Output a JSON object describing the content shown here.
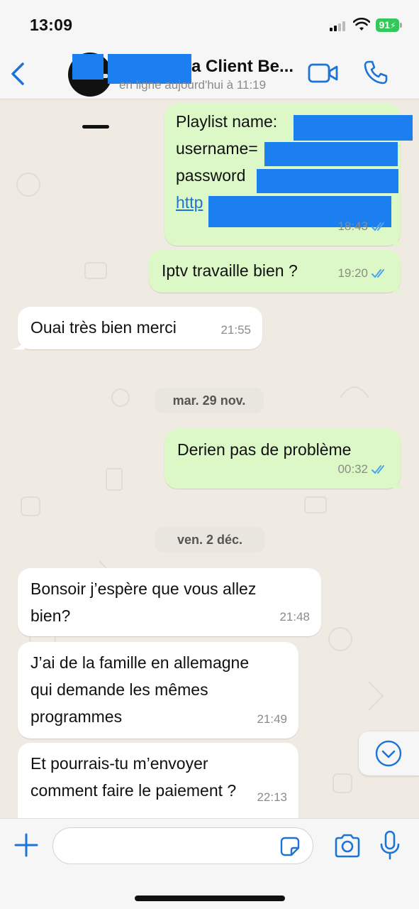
{
  "status_bar": {
    "time": "13:09",
    "battery": "91",
    "battery_color": "#34c759",
    "icons": [
      "signal-icon",
      "wifi-icon",
      "battery-charging-icon"
    ]
  },
  "header": {
    "contact_name": "a Client Be...",
    "contact_status": "en ligne aujourd'hui à 11:19",
    "icons": [
      "chevron-left-icon",
      "video-call-icon",
      "phone-call-icon"
    ],
    "accent_color": "#1d74d8"
  },
  "messages": [
    {
      "direction": "out",
      "lines": [
        "Playlist name:",
        "username=",
        "password",
        "http"
      ],
      "time": "18:43",
      "read": true
    },
    {
      "direction": "out",
      "text": "Iptv travaille bien ?",
      "time": "19:20",
      "read": true
    },
    {
      "direction": "in",
      "text": "Ouai très bien merci",
      "time": "21:55"
    },
    {
      "type": "date",
      "text": "mar. 29 nov."
    },
    {
      "direction": "out",
      "text": "Derien pas de problème",
      "time": "00:32",
      "read": true
    },
    {
      "type": "date",
      "text": "ven. 2 déc."
    },
    {
      "direction": "in",
      "lines": [
        "Bonsoir j’espère que vous allez",
        "bien?"
      ],
      "time": "21:48"
    },
    {
      "direction": "in",
      "lines": [
        "J’ai de la famille en allemagne",
        "qui demande les mêmes",
        "programmes"
      ],
      "time": "21:49"
    },
    {
      "direction": "in",
      "lines": [
        "Et pourrais-tu m’envoyer",
        "comment faire le paiement ?"
      ],
      "time": "22:13"
    }
  ],
  "input_bar": {
    "placeholder": "",
    "icons": [
      "plus-icon",
      "sticker-icon",
      "camera-icon",
      "microphone-icon"
    ]
  },
  "colors": {
    "outgoing_bubble": "#dcf8c6",
    "incoming_bubble": "#ffffff",
    "chat_background": "#efeae2",
    "redaction": "#1b7ff0",
    "read_ticks": "#4fa3e8"
  }
}
